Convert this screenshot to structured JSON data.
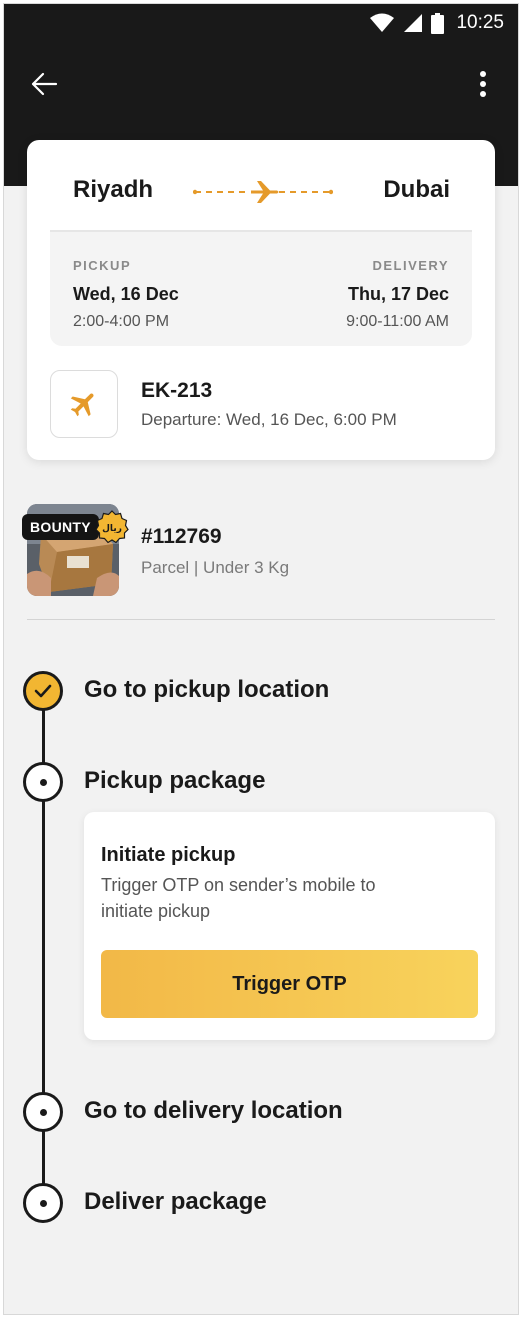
{
  "status_bar": {
    "time": "10:25"
  },
  "trip": {
    "origin": "Riyadh",
    "destination": "Dubai",
    "pickup": {
      "label": "PICKUP",
      "date": "Wed, 16 Dec",
      "time": "2:00-4:00 PM"
    },
    "delivery": {
      "label": "DELIVERY",
      "date": "Thu, 17 Dec",
      "time": "9:00-11:00 AM"
    },
    "flight": {
      "number": "EK-213",
      "departure": "Departure: Wed, 16 Dec, 6:00 PM"
    }
  },
  "parcel": {
    "badge": "BOUNTY",
    "coin_text": "ريال",
    "id": "#112769",
    "meta": "Parcel | Under 3 Kg"
  },
  "steps": [
    {
      "title": "Go to pickup location",
      "state": "done"
    },
    {
      "title": "Pickup package",
      "state": "active"
    },
    {
      "title": "Go to delivery location",
      "state": "pending"
    },
    {
      "title": "Deliver package",
      "state": "pending"
    }
  ],
  "action": {
    "title": "Initiate pickup",
    "description": "Trigger OTP on sender’s mobile to initiate pickup",
    "button_label": "Trigger OTP"
  },
  "colors": {
    "accent": "#F2B632",
    "topbar": "#191919",
    "background": "#F2F2F2"
  },
  "icons": [
    "wifi-icon",
    "signal-icon",
    "battery-icon",
    "back-arrow-icon",
    "more-vert-icon",
    "plane-icon",
    "check-icon",
    "coin-icon"
  ]
}
